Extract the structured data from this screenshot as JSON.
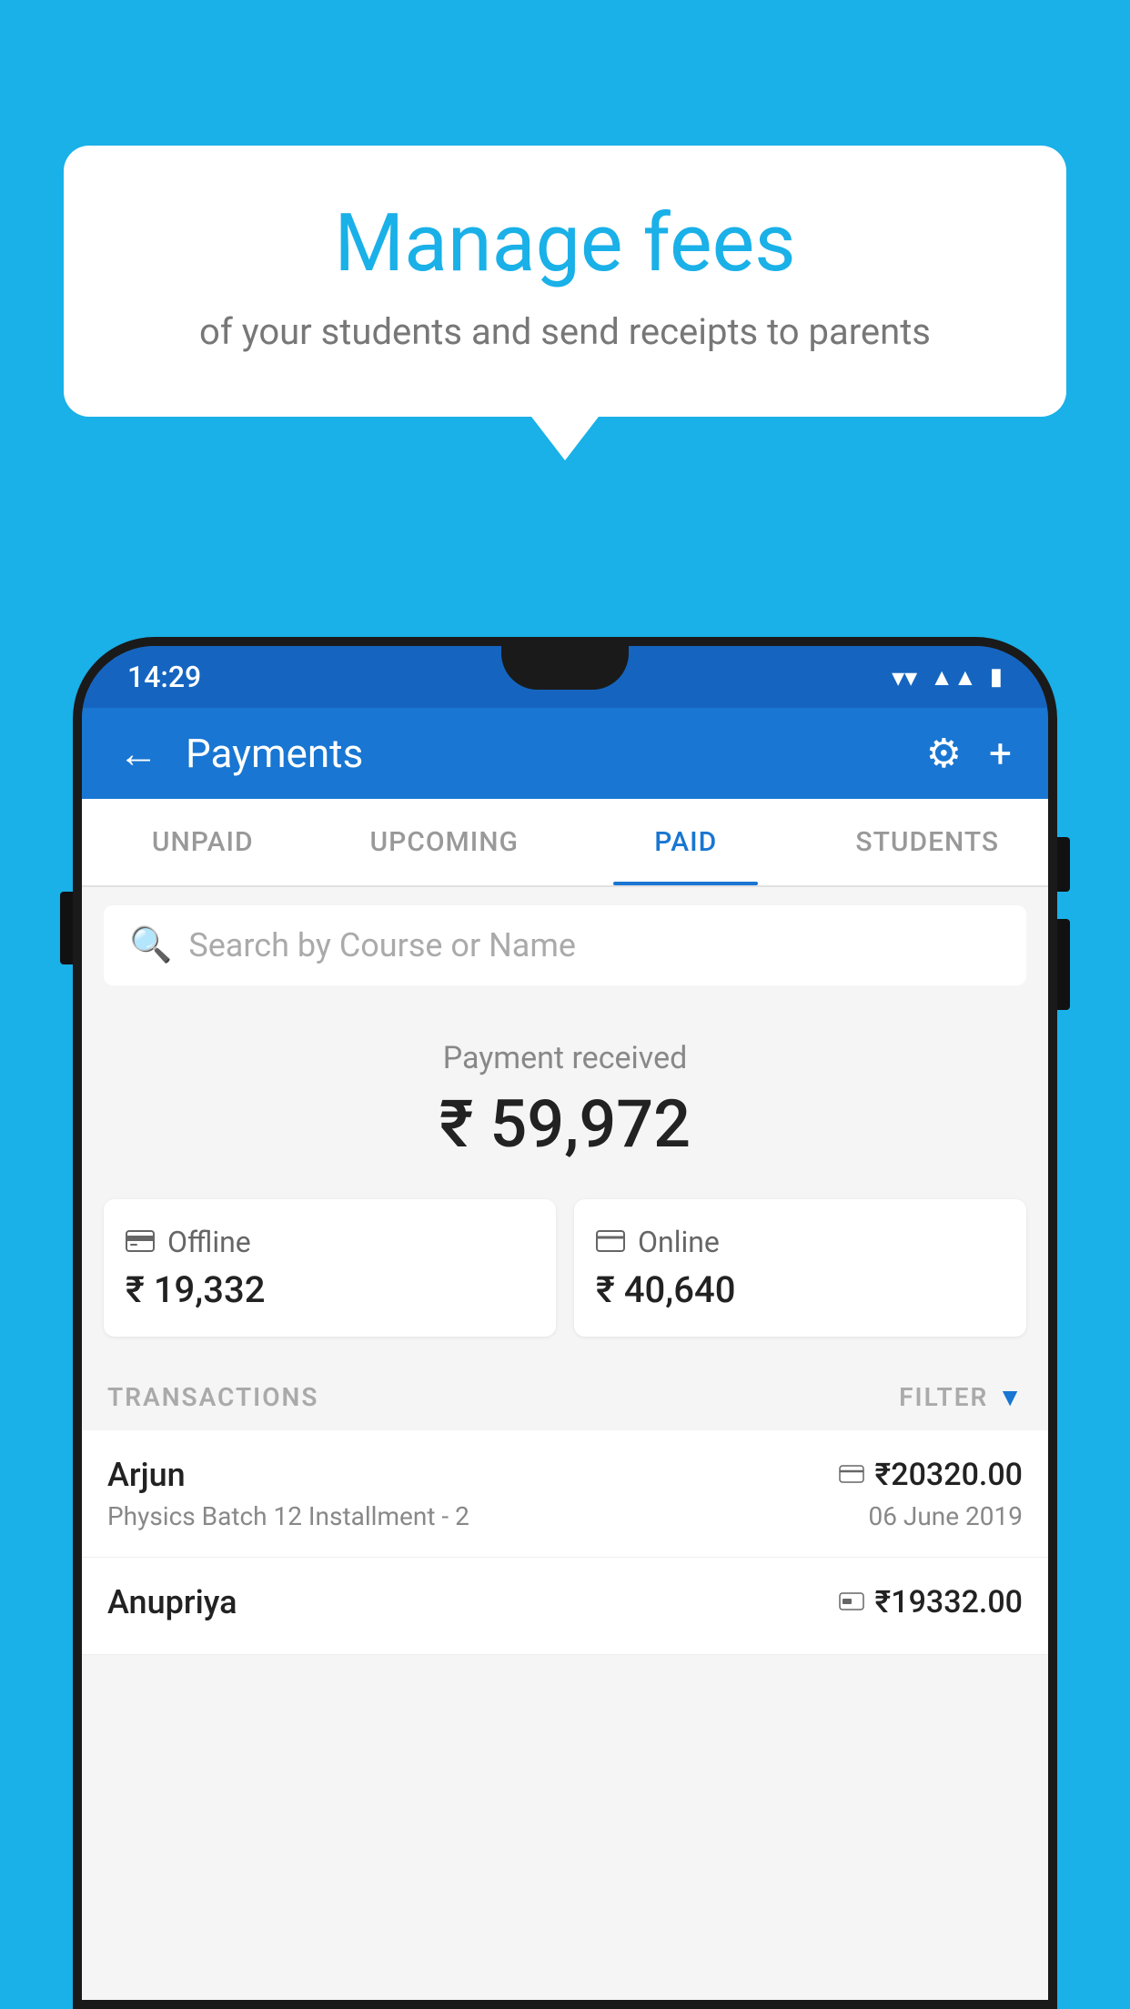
{
  "background_color": "#1ab0e8",
  "speech_bubble": {
    "title": "Manage fees",
    "subtitle": "of your students and send receipts to parents"
  },
  "phone": {
    "status_bar": {
      "time": "14:29",
      "wifi_icon": "▼",
      "signal_icon": "▲",
      "battery_icon": "▮"
    },
    "app_bar": {
      "title": "Payments",
      "back_icon": "←",
      "gear_icon": "⚙",
      "plus_icon": "+"
    },
    "tabs": [
      {
        "label": "UNPAID",
        "active": false
      },
      {
        "label": "UPCOMING",
        "active": false
      },
      {
        "label": "PAID",
        "active": true
      },
      {
        "label": "STUDENTS",
        "active": false
      }
    ],
    "search": {
      "placeholder": "Search by Course or Name"
    },
    "payment_received": {
      "label": "Payment received",
      "amount": "₹ 59,972"
    },
    "payment_cards": [
      {
        "type": "Offline",
        "amount": "₹ 19,332",
        "icon": "offline"
      },
      {
        "type": "Online",
        "amount": "₹ 40,640",
        "icon": "online"
      }
    ],
    "transactions_section": {
      "label": "TRANSACTIONS",
      "filter_label": "FILTER"
    },
    "transactions": [
      {
        "name": "Arjun",
        "amount": "₹20320.00",
        "payment_type": "online",
        "course": "Physics Batch 12 Installment - 2",
        "date": "06 June 2019"
      },
      {
        "name": "Anupriya",
        "amount": "₹19332.00",
        "payment_type": "offline",
        "course": "",
        "date": ""
      }
    ]
  }
}
